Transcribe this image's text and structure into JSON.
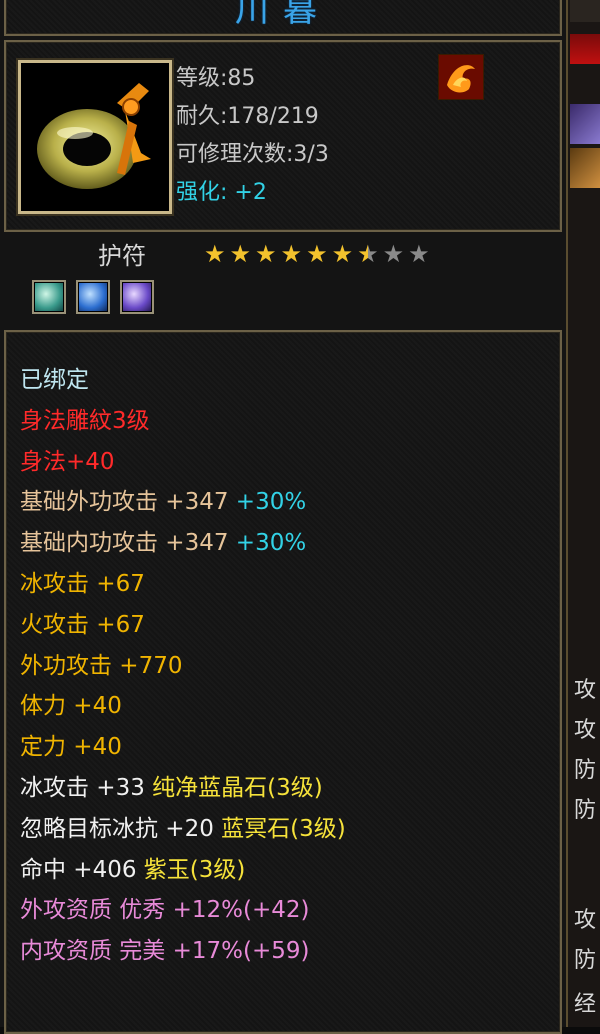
{
  "item": {
    "name_partial": "川暮",
    "level": "等级:85",
    "durability": "耐久:178/219",
    "repairs": "可修理次数:3/3",
    "enhance": "强化: +2"
  },
  "charm": {
    "label": "护符",
    "stars_filled": 6,
    "stars_half": 1,
    "stars_total": 9
  },
  "attributes": [
    {
      "text": "已绑定",
      "color": "#bfe6f0"
    },
    {
      "text": "身法雕紋3级",
      "color": "#ff2a2a"
    },
    {
      "text": "身法+40",
      "color": "#ff2a2a"
    },
    {
      "text": "基础外功攻击 +347",
      "suffix": " +30%",
      "color": "#e6c49a",
      "suffix_color": "#32d2e6"
    },
    {
      "text": "基础内功攻击 +347",
      "suffix": " +30%",
      "color": "#e6c49a",
      "suffix_color": "#32d2e6"
    },
    {
      "text": "冰攻击 +67",
      "color": "#f0b400"
    },
    {
      "text": "火攻击 +67",
      "color": "#f0b400"
    },
    {
      "text": "外功攻击 +770",
      "color": "#f0b400"
    },
    {
      "text": "体力 +40",
      "color": "#f0b400"
    },
    {
      "text": "定力 +40",
      "color": "#f0b400"
    },
    {
      "text": "冰攻击 +33 ",
      "suffix": "纯净蓝晶石(3级)",
      "color": "#f0f0f0",
      "suffix_color": "#f6e23a"
    },
    {
      "text": "忽略目标冰抗 +20 ",
      "suffix": "蓝冥石(3级)",
      "color": "#f0f0f0",
      "suffix_color": "#f6e23a"
    },
    {
      "text": "命中 +406 ",
      "suffix": "紫玉(3级)",
      "color": "#f0f0f0",
      "suffix_color": "#f6e23a"
    },
    {
      "text": "外攻资质  优秀 +12%(+42)",
      "color": "#e88ad8"
    },
    {
      "text": "内攻资质  完美 +17%(+59)",
      "color": "#e88ad8"
    }
  ],
  "side_panel": {
    "labels": [
      "攻",
      "攻",
      "防",
      "防",
      "攻",
      "防",
      "经"
    ]
  },
  "colors": {
    "frame": "#6c6147",
    "title": "#3aa4e8",
    "star_gold": "#f3c22d",
    "star_grey": "#8a8a8a"
  }
}
